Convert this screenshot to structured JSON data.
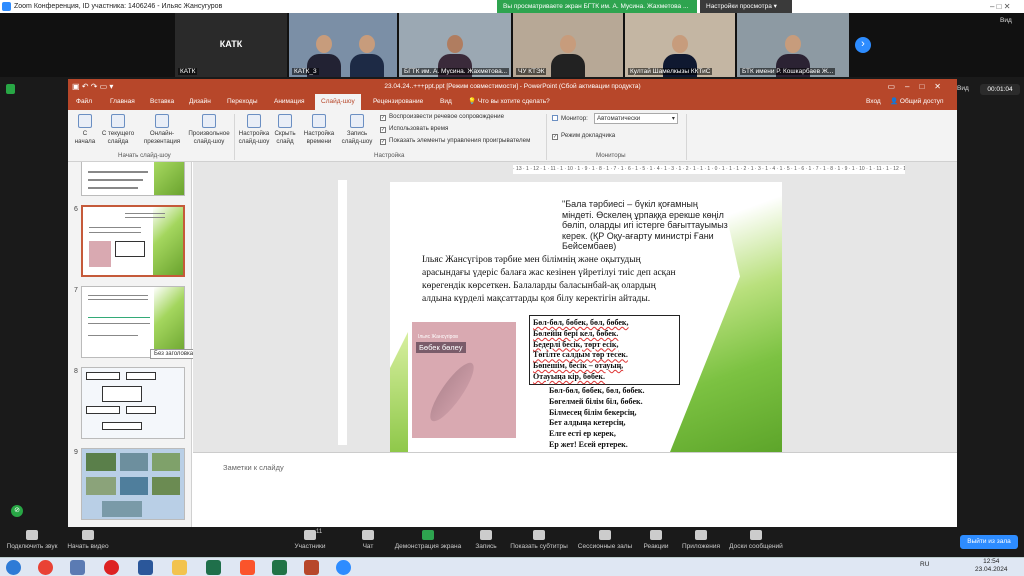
{
  "zoom": {
    "title": "Zoom Конференция, ID участника: 1406246 - Ильяс Жансугуров",
    "share_banner": "Вы просматриваете экран БГТК им. А. Мусина. Жахметова ...",
    "view_options": "Настройки просмотра",
    "view_btn": "Вид",
    "timer": "00:01:04",
    "vid_label": "Вид"
  },
  "participants": [
    {
      "name": "КАТК",
      "big": "КАТК"
    },
    {
      "name": "КАТК_3"
    },
    {
      "name": "БГТК им. А. Мусина. Жахметова..."
    },
    {
      "name": "ЧУ КТЭК"
    },
    {
      "name": "Култай Шамелкызы ККТиС"
    },
    {
      "name": "БТК имени Р. Кошкарбаев Ж..."
    }
  ],
  "ppt": {
    "title": "23.04.24..+++ppt.ppt [Режим совместимости] - PowerPoint (Сбой активации продукта)",
    "tabs": [
      "Файл",
      "Главная",
      "Вставка",
      "Дизайн",
      "Переходы",
      "Анимация",
      "Слайд-шоу",
      "Рецензирование",
      "Вид"
    ],
    "tell_me": "Что вы хотите сделать?",
    "signin": "Вход",
    "share": "Общий доступ",
    "ribbon": {
      "from_start": "С начала",
      "from_current": "С текущего слайда",
      "online": "Онлайн-презентация",
      "custom": "Произвольное слайд-шоу",
      "group1": "Начать слайд-шоу",
      "setup": "Настройка слайд-шоу",
      "hide": "Скрыть слайд",
      "rehearse": "Настройка времени",
      "record": "Запись слайд-шоу",
      "chk1": "Воспроизвести речевое сопровождение",
      "chk2": "Использовать время",
      "chk3": "Показать элементы управления проигрывателем",
      "group2": "Настройка",
      "monitor_label": "Монитор:",
      "monitor_value": "Автоматически",
      "presenter": "Режим докладчика",
      "group3": "Мониторы"
    },
    "tooltip": "Без заголовка",
    "thumb_nums": [
      "6",
      "7",
      "8",
      "9"
    ],
    "notes": "Заметки к слайду",
    "ruler": "· 13 · 1 · 12 · 1 · 11 · 1 · 10 · 1 · 9 · 1 · 8 · 1 · 7 · 1 · 6 · 1 · 5 · 1 · 4 · 1 · 3 · 1 · 2 · 1 · 1 · 1 · 0 · 1 · 1 · 1 · 2 · 1 · 3 · 1 · 4 · 1 · 5 · 1 · 6 · 1 · 7 · 1 · 8 · 1 · 9 · 1 · 10 · 1 · 11 · 1 · 12 · 1 · 13"
  },
  "slide": {
    "quote": "\"Бала тәрбиесі – бүкіл қоғамның міндеті. Өскелең ұрпаққа ерекше көңіл бөліп, оларды игі істерге бағыттауымыз керек. (ҚР Оқу-ағарту министрі Ғани Бейсембаев)",
    "body": "Ільяс Жансүгіров тәрбие мен білімнің және оқытудың арасындағы үдеріс балаға жас кезінен үйретілуі тиіс деп асқан көрегендік көрсеткен. Балаларды баласынбай-ақ олардың алдына күрделі мақсаттарды қоя білу керектігін айтады.",
    "book_author": "Ільяс Жансүгіров",
    "book_title": "Бөбек бөлеу",
    "poem1": [
      "Бөл-бөл, бөбек, бөл, бөбек,",
      "Бөлейін бері кел, бөбек.",
      "Бедерлі бесік, төрт есік,",
      "Төгілте салдым төр тесек.",
      "Бөпешім, бесік – отауың,",
      "Отауыңа кір, бөбек."
    ],
    "poem2": [
      "Бөл-бөл, бөбек, бөл, бөбек.",
      "Бөгелмей білім біл, бөбек.",
      "Білмесең білім бекерсің,",
      "Бет алдыңа кетерсің,",
      "Елге есті ер керек,",
      "Ер жет! Есей ертерек."
    ]
  },
  "zoombar": {
    "items": [
      "Подключить звук",
      "Начать видео",
      "Участники",
      "Чат",
      "Демонстрация экрана",
      "Запись",
      "Показать субтитры",
      "Сессионные залы",
      "Реакции",
      "Приложения",
      "Доски сообщений"
    ],
    "participants_count": "11",
    "leave": "Выйти из зала"
  },
  "tray": {
    "lang": "RU",
    "time": "12:54",
    "date": "23.04.2024"
  },
  "colors": {
    "ppt_accent": "#b7472a",
    "zoom_blue": "#2d8cff",
    "share_green": "#2ea44f"
  }
}
